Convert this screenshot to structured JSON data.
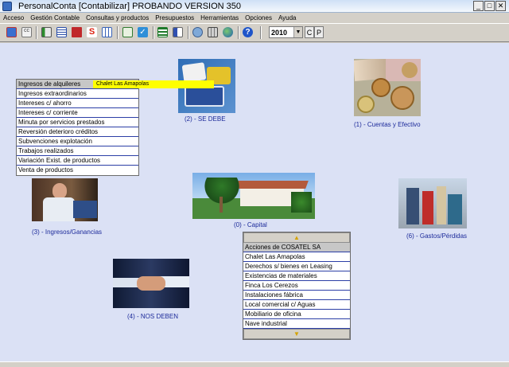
{
  "window": {
    "title": "PersonalConta [Contabilizar] PROBANDO VERSION 350",
    "buttons": [
      "_",
      "□",
      "✕"
    ]
  },
  "menu": [
    "Acceso",
    "Gestión Contable",
    "Consultas y productos",
    "Presupuestos",
    "Herramientas",
    "Opciones",
    "Ayuda"
  ],
  "toolbar": {
    "year": "2010",
    "c_label": "C",
    "p_label": "P"
  },
  "tooltip": "Chalet Las Amapolas",
  "income_menu": [
    "Ingresos de alquileres",
    "Ingresos extraordinarios",
    "Intereses c/ ahorro",
    "Intereses c/ corriente",
    "Minuta por servicios prestados",
    "Reversión deterioro créditos",
    "Subvenciones explotación",
    "Trabajos realizados",
    "Variación Exist. de productos",
    "Venta de productos"
  ],
  "capital_menu": [
    "Acciones de COSATEL SA",
    "Chalet Las Amapolas",
    "Derechos s/ bienes en Leasing",
    "Existencias de materiales",
    "Finca Los Cerezos",
    "Instalaciones fábrica",
    "Local comercial c/ Aguas",
    "Mobiliario de oficina",
    "Nave industrial"
  ],
  "captions": {
    "se_debe": "(2) - SE DEBE",
    "cuentas": "(1) - Cuentas y Efectivo",
    "ingresos": "(3) - Ingresos/Ganancias",
    "capital": "(0) - Capital",
    "gastos": "(6) - Gastos/Pérdidas",
    "nos_deben": "(4) - NOS DEBEN"
  },
  "scroll": {
    "up": "▲",
    "down": "▼"
  }
}
